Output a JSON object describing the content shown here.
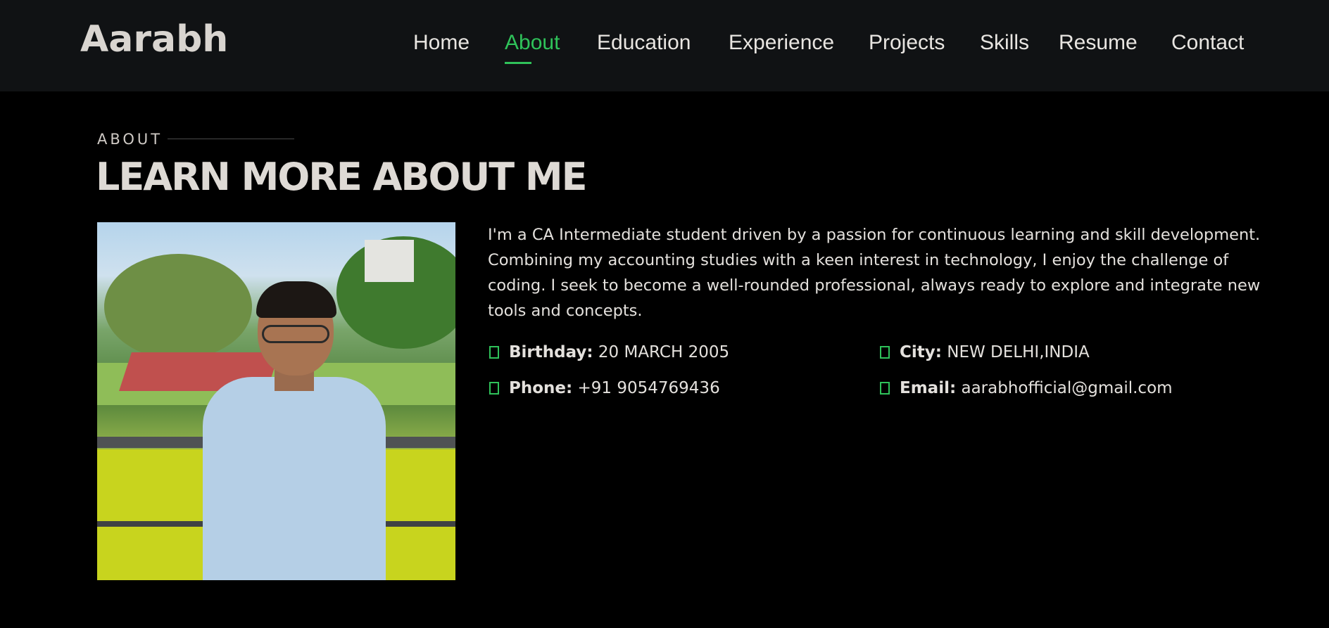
{
  "header": {
    "logo": "Aarabh",
    "nav": [
      {
        "label": "Home"
      },
      {
        "label": "About",
        "active": true
      },
      {
        "label": "Education"
      },
      {
        "label": "Experience"
      },
      {
        "label": "Projects"
      },
      {
        "label": "Skills"
      },
      {
        "label": "Resume"
      },
      {
        "label": "Contact"
      }
    ]
  },
  "about": {
    "section_label": "ABOUT",
    "title": "LEARN MORE ABOUT ME",
    "bio": "I'm a CA Intermediate student driven by a passion for continuous learning and skill development. Combining my accounting studies with a keen interest in technology, I enjoy the challenge of coding. I seek to become a well-rounded professional, always ready to explore and integrate new tools and concepts.",
    "details": {
      "birthday": {
        "key": "Birthday:",
        "value": "20 MARCH 2005"
      },
      "city": {
        "key": "City:",
        "value": "NEW DELHI,INDIA"
      },
      "phone": {
        "key": "Phone:",
        "value": "+91 9054769436"
      },
      "email": {
        "key": "Email:",
        "value": "aarabhofficial@gmail.com"
      }
    }
  },
  "colors": {
    "accent": "#2fc25a",
    "header_bg": "#101214",
    "page_bg": "#000000"
  },
  "icons": {
    "detail_bullet": "chevron-right-icon"
  }
}
